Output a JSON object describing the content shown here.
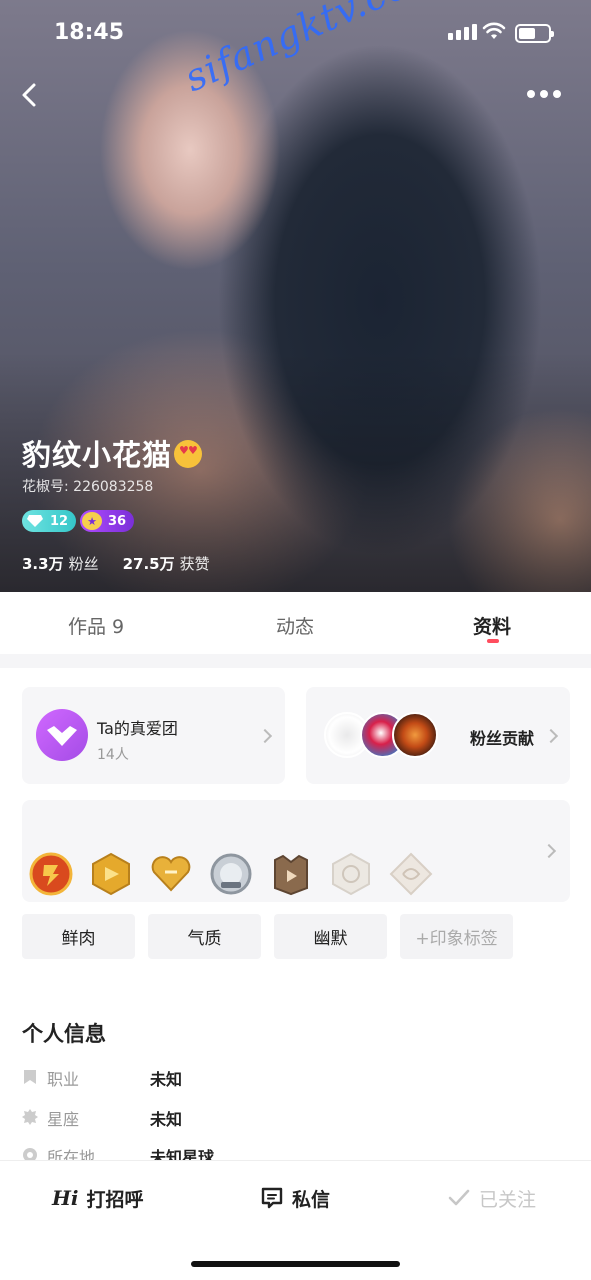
{
  "status": {
    "time": "18:45"
  },
  "watermark": "sifangktv.com",
  "profile": {
    "nickname": "豹纹小花猫",
    "emoji": "smiling-face-with-heart-eyes",
    "uid_label": "花椒号:",
    "uid": "226083258",
    "badges": [
      {
        "icon": "diamond-icon",
        "value": "12",
        "color": "#35c7c9"
      },
      {
        "icon": "star-icon",
        "value": "36",
        "color": "#9b3ff0"
      }
    ],
    "fans_count": "3.3万",
    "fans_label": "粉丝",
    "likes_count": "27.5万",
    "likes_label": "获赞"
  },
  "tabs": [
    {
      "label": "作品 9",
      "active": false
    },
    {
      "label": "动态",
      "active": false
    },
    {
      "label": "资料",
      "active": true
    }
  ],
  "fan_club": {
    "title": "Ta的真爱团",
    "members": "14人"
  },
  "fans_contribution": {
    "label": "粉丝贡献"
  },
  "medals": [
    "medal-1",
    "medal-2",
    "medal-3",
    "medal-4",
    "medal-5",
    "medal-6",
    "medal-7"
  ],
  "tags": [
    "鲜肉",
    "气质",
    "幽默",
    "+印象标签"
  ],
  "personal_info": {
    "title": "个人信息",
    "rows": [
      {
        "icon": "bookmark-icon",
        "label": "职业",
        "value": "未知"
      },
      {
        "icon": "gear-star-icon",
        "label": "星座",
        "value": "未知"
      },
      {
        "icon": "location-icon",
        "label": "所在地",
        "value": "未知星球"
      }
    ]
  },
  "bottom_bar": {
    "greet_prefix": "Hi",
    "greet": "打招呼",
    "message": "私信",
    "followed": "已关注"
  },
  "colors": {
    "accent": "#ff4d5e",
    "purple": "#b34cf5"
  }
}
